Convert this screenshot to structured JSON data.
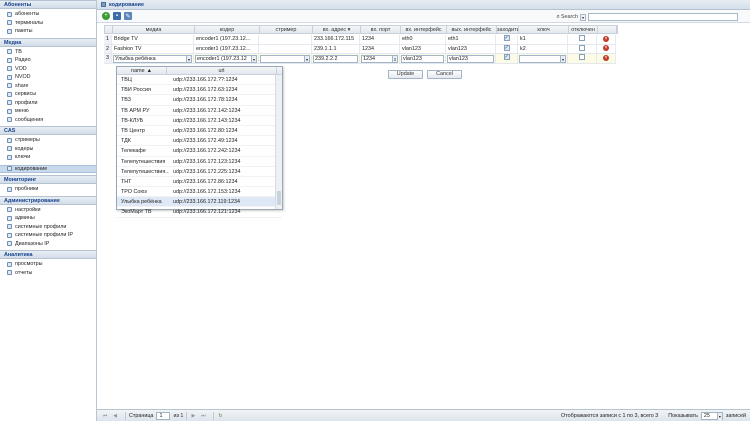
{
  "sidebar": {
    "sections": [
      {
        "title": "Абоненты",
        "items": [
          "абоненты",
          "терминалы",
          "пакеты"
        ]
      },
      {
        "title": "Медиа",
        "items": [
          "ТВ",
          "Радио",
          "VOD",
          "NVOD",
          "share",
          "сервисы",
          "профили",
          "меню",
          "сообщения"
        ]
      },
      {
        "title": "CAS",
        "items": [
          "стримеры",
          "кодеры",
          "ключи"
        ]
      },
      {
        "title": "",
        "items": [
          "кодирование"
        ]
      },
      {
        "title": "Мониторинг",
        "items": [
          "пробники"
        ]
      },
      {
        "title": "Администрирование",
        "items": [
          "настройки",
          "админы",
          "системные профили",
          "системные профили IP",
          "Диапазоны IP"
        ]
      },
      {
        "title": "Аналитика",
        "items": [
          "просмотры",
          "отчеты"
        ]
      }
    ],
    "active_item": "кодирование"
  },
  "header": {
    "title": "кодирование"
  },
  "search": {
    "label": "Search",
    "dropdown_arrow": "▾",
    "value": ""
  },
  "columns": [
    "",
    "медиа",
    "кодер",
    "стример",
    "вх. адрес",
    "вх. порт",
    "вх. интерфейс",
    "вых. интерфейс",
    "заходить",
    "ключ",
    "отключен",
    ""
  ],
  "sort_indicator": "вх. адрес",
  "rows": [
    {
      "n": "1",
      "media": "Bridge TV",
      "coder": "encoder1 (197.23.12...",
      "streamer": "",
      "in_addr": "233.166.172.115",
      "in_port": "1234",
      "in_if": "eth0",
      "out_if": "eth1",
      "enter": true,
      "key": "k1",
      "disabled": false
    },
    {
      "n": "2",
      "media": "Fashion TV",
      "coder": "encoder1 (197.23.12...",
      "streamer": "",
      "in_addr": "239.1.1.1",
      "in_port": "1234",
      "in_if": "vlan123",
      "out_if": "vlan123",
      "enter": true,
      "key": "k2",
      "disabled": false
    },
    {
      "n": "3",
      "media": "Улыбка ребёнка",
      "coder": "encoder1 (197.23.12",
      "streamer": "",
      "in_addr": "239.2.2.2",
      "in_port": "1234",
      "in_if": "vlan123",
      "out_if": "vlan123",
      "enter": true,
      "key": "",
      "disabled": false
    }
  ],
  "edit_buttons": {
    "update": "Update",
    "cancel": "Cancel"
  },
  "media_dropdown": {
    "headers": {
      "name": "name",
      "sort": "▲",
      "url": "url"
    },
    "items": [
      {
        "name": "ТВЦ",
        "url": "udp://233.166.172.??:1234"
      },
      {
        "name": "ТВИ Россия",
        "url": "udp://233.166.172.63:1234"
      },
      {
        "name": "ТВ3",
        "url": "udp://233.166.172.78:1234"
      },
      {
        "name": "ТВ АРМ РУ",
        "url": "udp://233.166.172.142:1234"
      },
      {
        "name": "ТВ-КЛУБ",
        "url": "udp://233.166.172.143:1234"
      },
      {
        "name": "ТВ Центр",
        "url": "udp://233.166.172.80:1234"
      },
      {
        "name": "ТДК",
        "url": "udp://233.166.172.49:1234"
      },
      {
        "name": "Телекафе",
        "url": "udp://233.166.172.242:1234"
      },
      {
        "name": "Телепутешествия",
        "url": "udp://233.166.172.123:1234"
      },
      {
        "name": "Телепутешествия...",
        "url": "udp://233.166.172.225:1234"
      },
      {
        "name": "ТНТ",
        "url": "udp://233.166.172.86:1234"
      },
      {
        "name": "ТРО Союз",
        "url": "udp://233.166.172.153:1234"
      },
      {
        "name": "Улыбка ребёнка",
        "url": "udp://233.166.172.119:1234"
      },
      {
        "name": "ЭкоМарт ТВ",
        "url": "udp://233.166.172.121:1234"
      }
    ],
    "selected_index": 12
  },
  "pager": {
    "page_label": "Страница",
    "page_value": "1",
    "of_label": "из 1",
    "records_text": "Отображаются записи с 1 по 3, всего 3",
    "show_label": "Показывать",
    "page_size": "25",
    "records_suffix": "записей"
  },
  "colors": {
    "accent": "#15428b",
    "delete": "#c0392b",
    "add": "#3a9b32"
  }
}
